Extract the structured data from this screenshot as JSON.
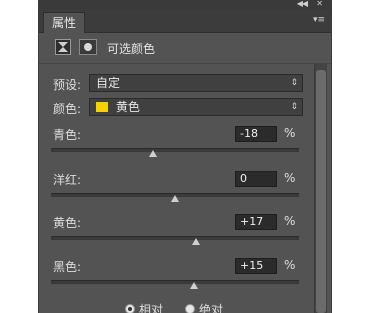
{
  "panel": {
    "tab_title": "属性",
    "adjustment_title": "可选颜色",
    "collapse_glyph": "◀◀",
    "close_glyph": "✕",
    "menu_glyph": "▾≡"
  },
  "preset": {
    "label": "预设:",
    "value": "自定"
  },
  "colors": {
    "label": "颜色:",
    "value": "黄色",
    "swatch_color": "#f6d200"
  },
  "sliders": [
    {
      "label": "青色:",
      "value": "-18",
      "unit": "%",
      "level": -0.18
    },
    {
      "label": "洋红:",
      "value": "0",
      "unit": "%",
      "level": 0
    },
    {
      "label": "黄色:",
      "value": "+17",
      "unit": "%",
      "level": 0.17
    },
    {
      "label": "黑色:",
      "value": "+15",
      "unit": "%",
      "level": 0.15
    }
  ],
  "method": {
    "options": [
      "相对",
      "绝对"
    ],
    "selected": "相对"
  }
}
